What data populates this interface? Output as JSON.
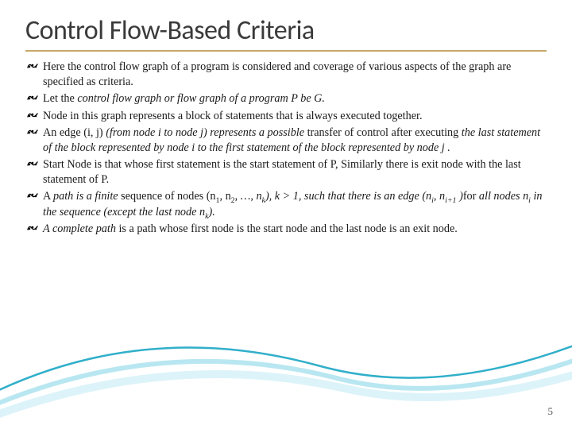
{
  "title": "Control Flow-Based Criteria",
  "bullets": [
    {
      "segments": [
        {
          "t": "Here the control flow graph of a program is considered and coverage of various aspects of the graph are specified as criteria.",
          "i": false
        }
      ]
    },
    {
      "segments": [
        {
          "t": "Let the ",
          "i": false
        },
        {
          "t": "control flow graph or flow graph of a program P be G.",
          "i": true
        }
      ]
    },
    {
      "segments": [
        {
          "t": "Node in this graph represents a block of statements that is always executed together.",
          "i": false
        }
      ]
    },
    {
      "segments": [
        {
          "t": "An edge (i, j) ",
          "i": false
        },
        {
          "t": "(from node i to node j) represents a possible ",
          "i": true
        },
        {
          "t": "transfer of control after executing ",
          "i": false
        },
        {
          "t": "the last statement of the block represented by node i to the first statement of the block represented by node j .",
          "i": true
        }
      ]
    },
    {
      "segments": [
        {
          "t": "Start Node is that  whose first statement is the start statement of  P, Similarly there is exit node with the last statement of P.",
          "i": false
        }
      ]
    },
    {
      "segments": [
        {
          "t": "A ",
          "i": false
        },
        {
          "t": "path is a finite ",
          "i": true
        },
        {
          "t": "sequence of nodes (n",
          "i": false
        },
        {
          "t": "1",
          "i": false,
          "sub": true
        },
        {
          "t": ", n",
          "i": false
        },
        {
          "t": "2",
          "i": false,
          "sub": true
        },
        {
          "t": ", …, n",
          "i": true
        },
        {
          "t": "k",
          "i": true,
          "sub": true
        },
        {
          "t": "), k >  1, such that there is an edge (n",
          "i": true
        },
        {
          "t": "i",
          "i": true,
          "sub": true
        },
        {
          "t": ", n",
          "i": true
        },
        {
          "t": "i+1",
          "i": true,
          "sub": true
        },
        {
          "t": " )",
          "i": true
        },
        {
          "t": "for ",
          "i": false
        },
        {
          "t": "all nodes n",
          "i": true
        },
        {
          "t": "i",
          "i": true,
          "sub": true
        },
        {
          "t": " in the sequence (except the last node n",
          "i": true
        },
        {
          "t": "k",
          "i": true,
          "sub": true
        },
        {
          "t": ").",
          "i": true
        }
      ]
    },
    {
      "segments": [
        {
          "t": " A complete path ",
          "i": true
        },
        {
          "t": "is a path whose first node is the start node and the last node is an exit node.",
          "i": false
        }
      ]
    }
  ],
  "page_number": "5"
}
